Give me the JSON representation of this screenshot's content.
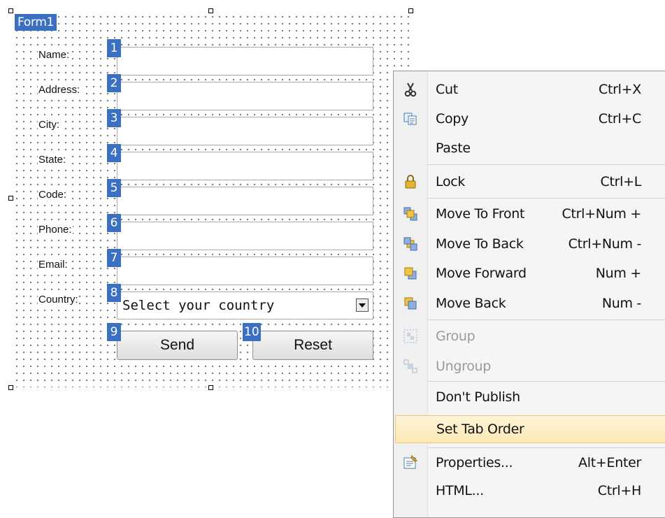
{
  "form": {
    "title": "Form1",
    "fields": [
      {
        "label": "Name:",
        "tab": "1"
      },
      {
        "label": "Address:",
        "tab": "2"
      },
      {
        "label": "City:",
        "tab": "3"
      },
      {
        "label": "State:",
        "tab": "4"
      },
      {
        "label": "Code:",
        "tab": "5"
      },
      {
        "label": "Phone:",
        "tab": "6"
      },
      {
        "label": "Email:",
        "tab": "7"
      }
    ],
    "country": {
      "label": "Country:",
      "tab": "8",
      "selected": "Select your country"
    },
    "send": {
      "label": "Send",
      "tab": "9"
    },
    "reset": {
      "label": "Reset",
      "tab": "10"
    }
  },
  "menu": {
    "items": [
      {
        "label": "Cut",
        "shortcut": "Ctrl+X",
        "icon": "scissors-icon"
      },
      {
        "label": "Copy",
        "shortcut": "Ctrl+C",
        "icon": "copy-icon"
      },
      {
        "label": "Paste",
        "shortcut": ""
      },
      {
        "label": "Lock",
        "shortcut": "Ctrl+L",
        "icon": "lock-icon"
      },
      {
        "label": "Move To Front",
        "shortcut": "Ctrl+Num +",
        "icon": "move-to-front-icon"
      },
      {
        "label": "Move To Back",
        "shortcut": "Ctrl+Num -",
        "icon": "move-to-back-icon"
      },
      {
        "label": "Move Forward",
        "shortcut": "Num +",
        "icon": "move-forward-icon"
      },
      {
        "label": "Move Back",
        "shortcut": "Num -",
        "icon": "move-back-icon"
      },
      {
        "label": "Group",
        "shortcut": "",
        "icon": "group-icon",
        "disabled": true
      },
      {
        "label": "Ungroup",
        "shortcut": "",
        "icon": "ungroup-icon",
        "disabled": true
      },
      {
        "label": "Don't Publish",
        "shortcut": ""
      },
      {
        "label": "Set Tab Order",
        "shortcut": "",
        "highlighted": true
      },
      {
        "label": "Properties...",
        "shortcut": "Alt+Enter",
        "icon": "properties-icon"
      },
      {
        "label": "HTML...",
        "shortcut": "Ctrl+H"
      }
    ]
  },
  "colors": {
    "badge": "#3a6fc2",
    "menu_highlight": "#fde9b6",
    "menu_separator": "#c5d6ea"
  }
}
